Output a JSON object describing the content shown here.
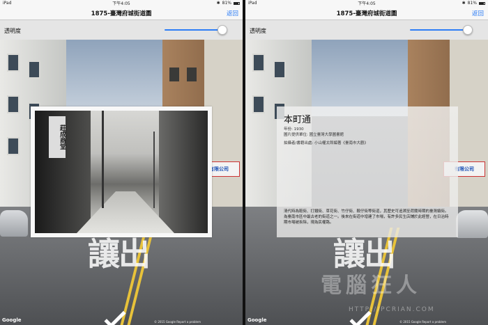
{
  "status_bar": {
    "device": "iPad",
    "wifi_icon": "wifi-icon",
    "time": "下午4:05",
    "battery": "81%",
    "bluetooth_icon": "bluetooth-icon"
  },
  "nav": {
    "title": "1875-臺灣府城街道圖",
    "back_label": "返回"
  },
  "transparency": {
    "label": "透明度",
    "left_value": 1.0,
    "right_value": 1.0
  },
  "overlay_photo": {
    "sign_text": "莊成商堂"
  },
  "street": {
    "road_text": "讓出",
    "shop_sign": "有限公司"
  },
  "info_card": {
    "title": "本町通",
    "year": "年份: 1930",
    "source": "圖片提供單位: 國立臺灣大學圖書館",
    "author": "拍攝者/書籍出處: 小山權太郎編著《臺南市大觀》",
    "body": "清代時為鞋街、打鐵街、草花街、竹仔街、鞍仔街等街道，其歷史可追溯至荷蘭時期的臺灣鎮街。為臺南市區中最古老的街道之一。後來在街道中增建了市場，有許多民生店鋪於此經營，在日治時期市場被拆除，現為民權路。"
  },
  "footer": {
    "google": "Google",
    "copyright": "© 2015 Google    Report a problem"
  },
  "watermark": {
    "line1": "電腦狂人",
    "line2": "HTTP://PCRIAN.COM"
  },
  "colors": {
    "accent": "#2d7df6",
    "nav_bg": "#f7f7f7"
  }
}
